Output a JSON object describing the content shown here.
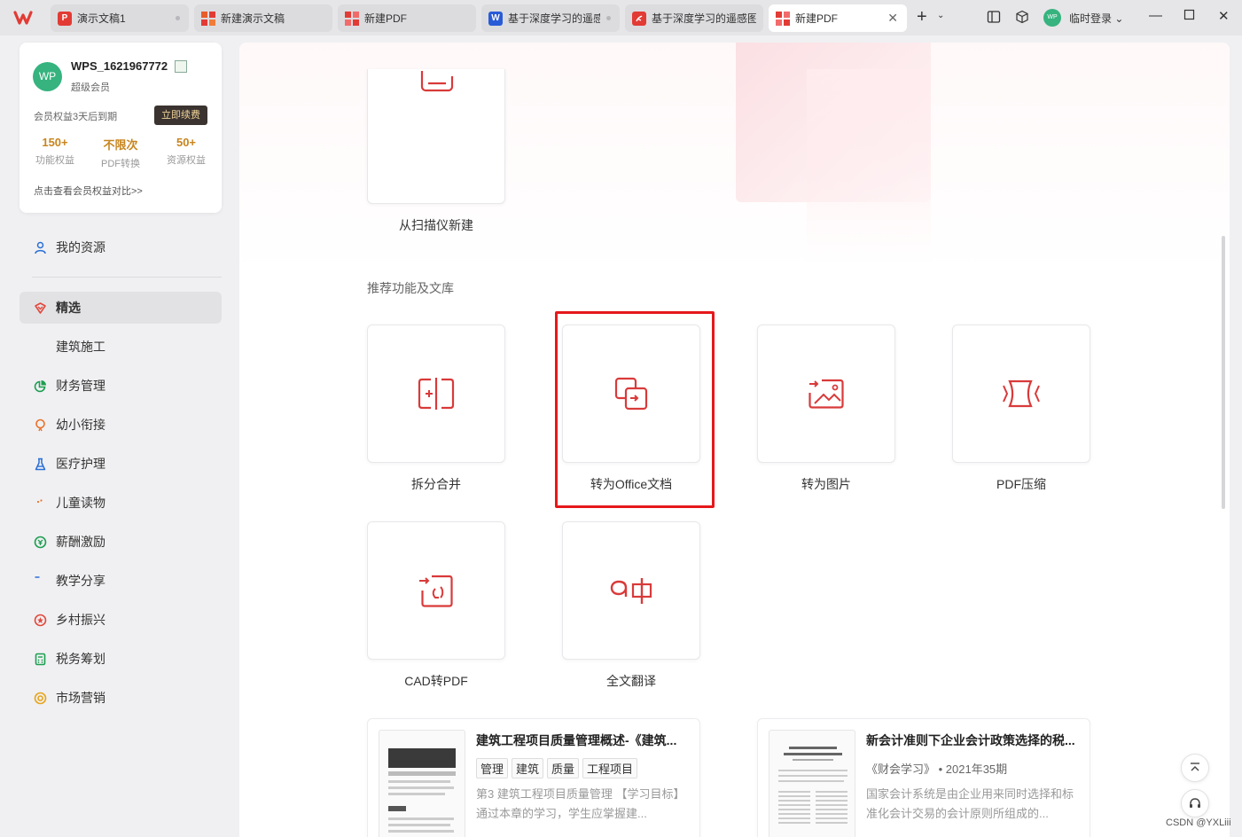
{
  "tabs": [
    {
      "label": "演示文稿1",
      "icon": "presentation-icon",
      "icon_char": "P"
    },
    {
      "label": "新建演示文稿",
      "icon": "new-presentation-icon",
      "icon_char": ""
    },
    {
      "label": "新建PDF",
      "icon": "pdf-icon",
      "icon_char": ""
    },
    {
      "label": "基于深度学习的遥感",
      "icon": "word-doc-icon",
      "icon_char": "W"
    },
    {
      "label": "基于深度学习的遥感图",
      "icon": "pdf-doc-icon",
      "icon_char": ""
    },
    {
      "label": "新建PDF",
      "icon": "pdf-icon",
      "icon_char": ""
    }
  ],
  "titlebar": {
    "login_label": "临时登录 ⌄",
    "avatar_text": "WP"
  },
  "member": {
    "avatar_text": "WP",
    "username": "WPS_1621967772",
    "level": "超级会员",
    "expire_text": "会员权益3天后到期",
    "renew_label": "立即续费",
    "stats": [
      {
        "value": "150+",
        "label": "功能权益"
      },
      {
        "value": "不限次",
        "label": "PDF转换"
      },
      {
        "value": "50+",
        "label": "资源权益"
      }
    ],
    "compare_link": "点击查看会员权益对比>>"
  },
  "sidebar": {
    "resources_label": "我的资源",
    "items": [
      {
        "label": "精选",
        "icon": "featured-icon",
        "color": "#e2483d"
      },
      {
        "label": "建筑施工",
        "icon": "wrench-icon",
        "color": "#2a6fd6"
      },
      {
        "label": "财务管理",
        "icon": "pie-chart-icon",
        "color": "#1e9e52"
      },
      {
        "label": "幼小衔接",
        "icon": "balloon-icon",
        "color": "#e8722a"
      },
      {
        "label": "医疗护理",
        "icon": "flask-icon",
        "color": "#2a6fd6"
      },
      {
        "label": "儿童读物",
        "icon": "palette-icon",
        "color": "#e8722a"
      },
      {
        "label": "薪酬激励",
        "icon": "coin-icon",
        "color": "#1e9e52"
      },
      {
        "label": "教学分享",
        "icon": "book-icon",
        "color": "#2a6fd6"
      },
      {
        "label": "乡村振兴",
        "icon": "star-badge-icon",
        "color": "#e2483d"
      },
      {
        "label": "税务筹划",
        "icon": "calculator-icon",
        "color": "#1e9e52"
      },
      {
        "label": "市场营销",
        "icon": "target-icon",
        "color": "#e8a31a"
      }
    ]
  },
  "main": {
    "scanner_label": "从扫描仪新建",
    "section_title": "推荐功能及文库",
    "features": [
      {
        "label": "拆分合并",
        "icon": "split-merge-icon"
      },
      {
        "label": "转为Office文档",
        "icon": "convert-office-icon"
      },
      {
        "label": "转为图片",
        "icon": "convert-image-icon"
      },
      {
        "label": "PDF压缩",
        "icon": "compress-icon"
      },
      {
        "label": "CAD转PDF",
        "icon": "cad-convert-icon"
      },
      {
        "label": "全文翻译",
        "icon": "translate-icon"
      }
    ],
    "docs": [
      {
        "title": "建筑工程项目质量管理概述-《建筑...",
        "tags": [
          "管理",
          "建筑",
          "质量",
          "工程项目"
        ],
        "desc": "第3 建筑工程项目质量管理 【学习目标】 通过本章的学习，学生应掌握建..."
      },
      {
        "title": "新会计准则下企业会计政策选择的税...",
        "meta": "《财会学习》 • 2021年35期",
        "desc": "国家会计系统是由企业用来同时选择和标准化会计交易的会计原则所组成的..."
      }
    ]
  },
  "accent_color": "#d93a3a",
  "highlight_color": "#e5181b",
  "watermark": "CSDN @YXLiii"
}
